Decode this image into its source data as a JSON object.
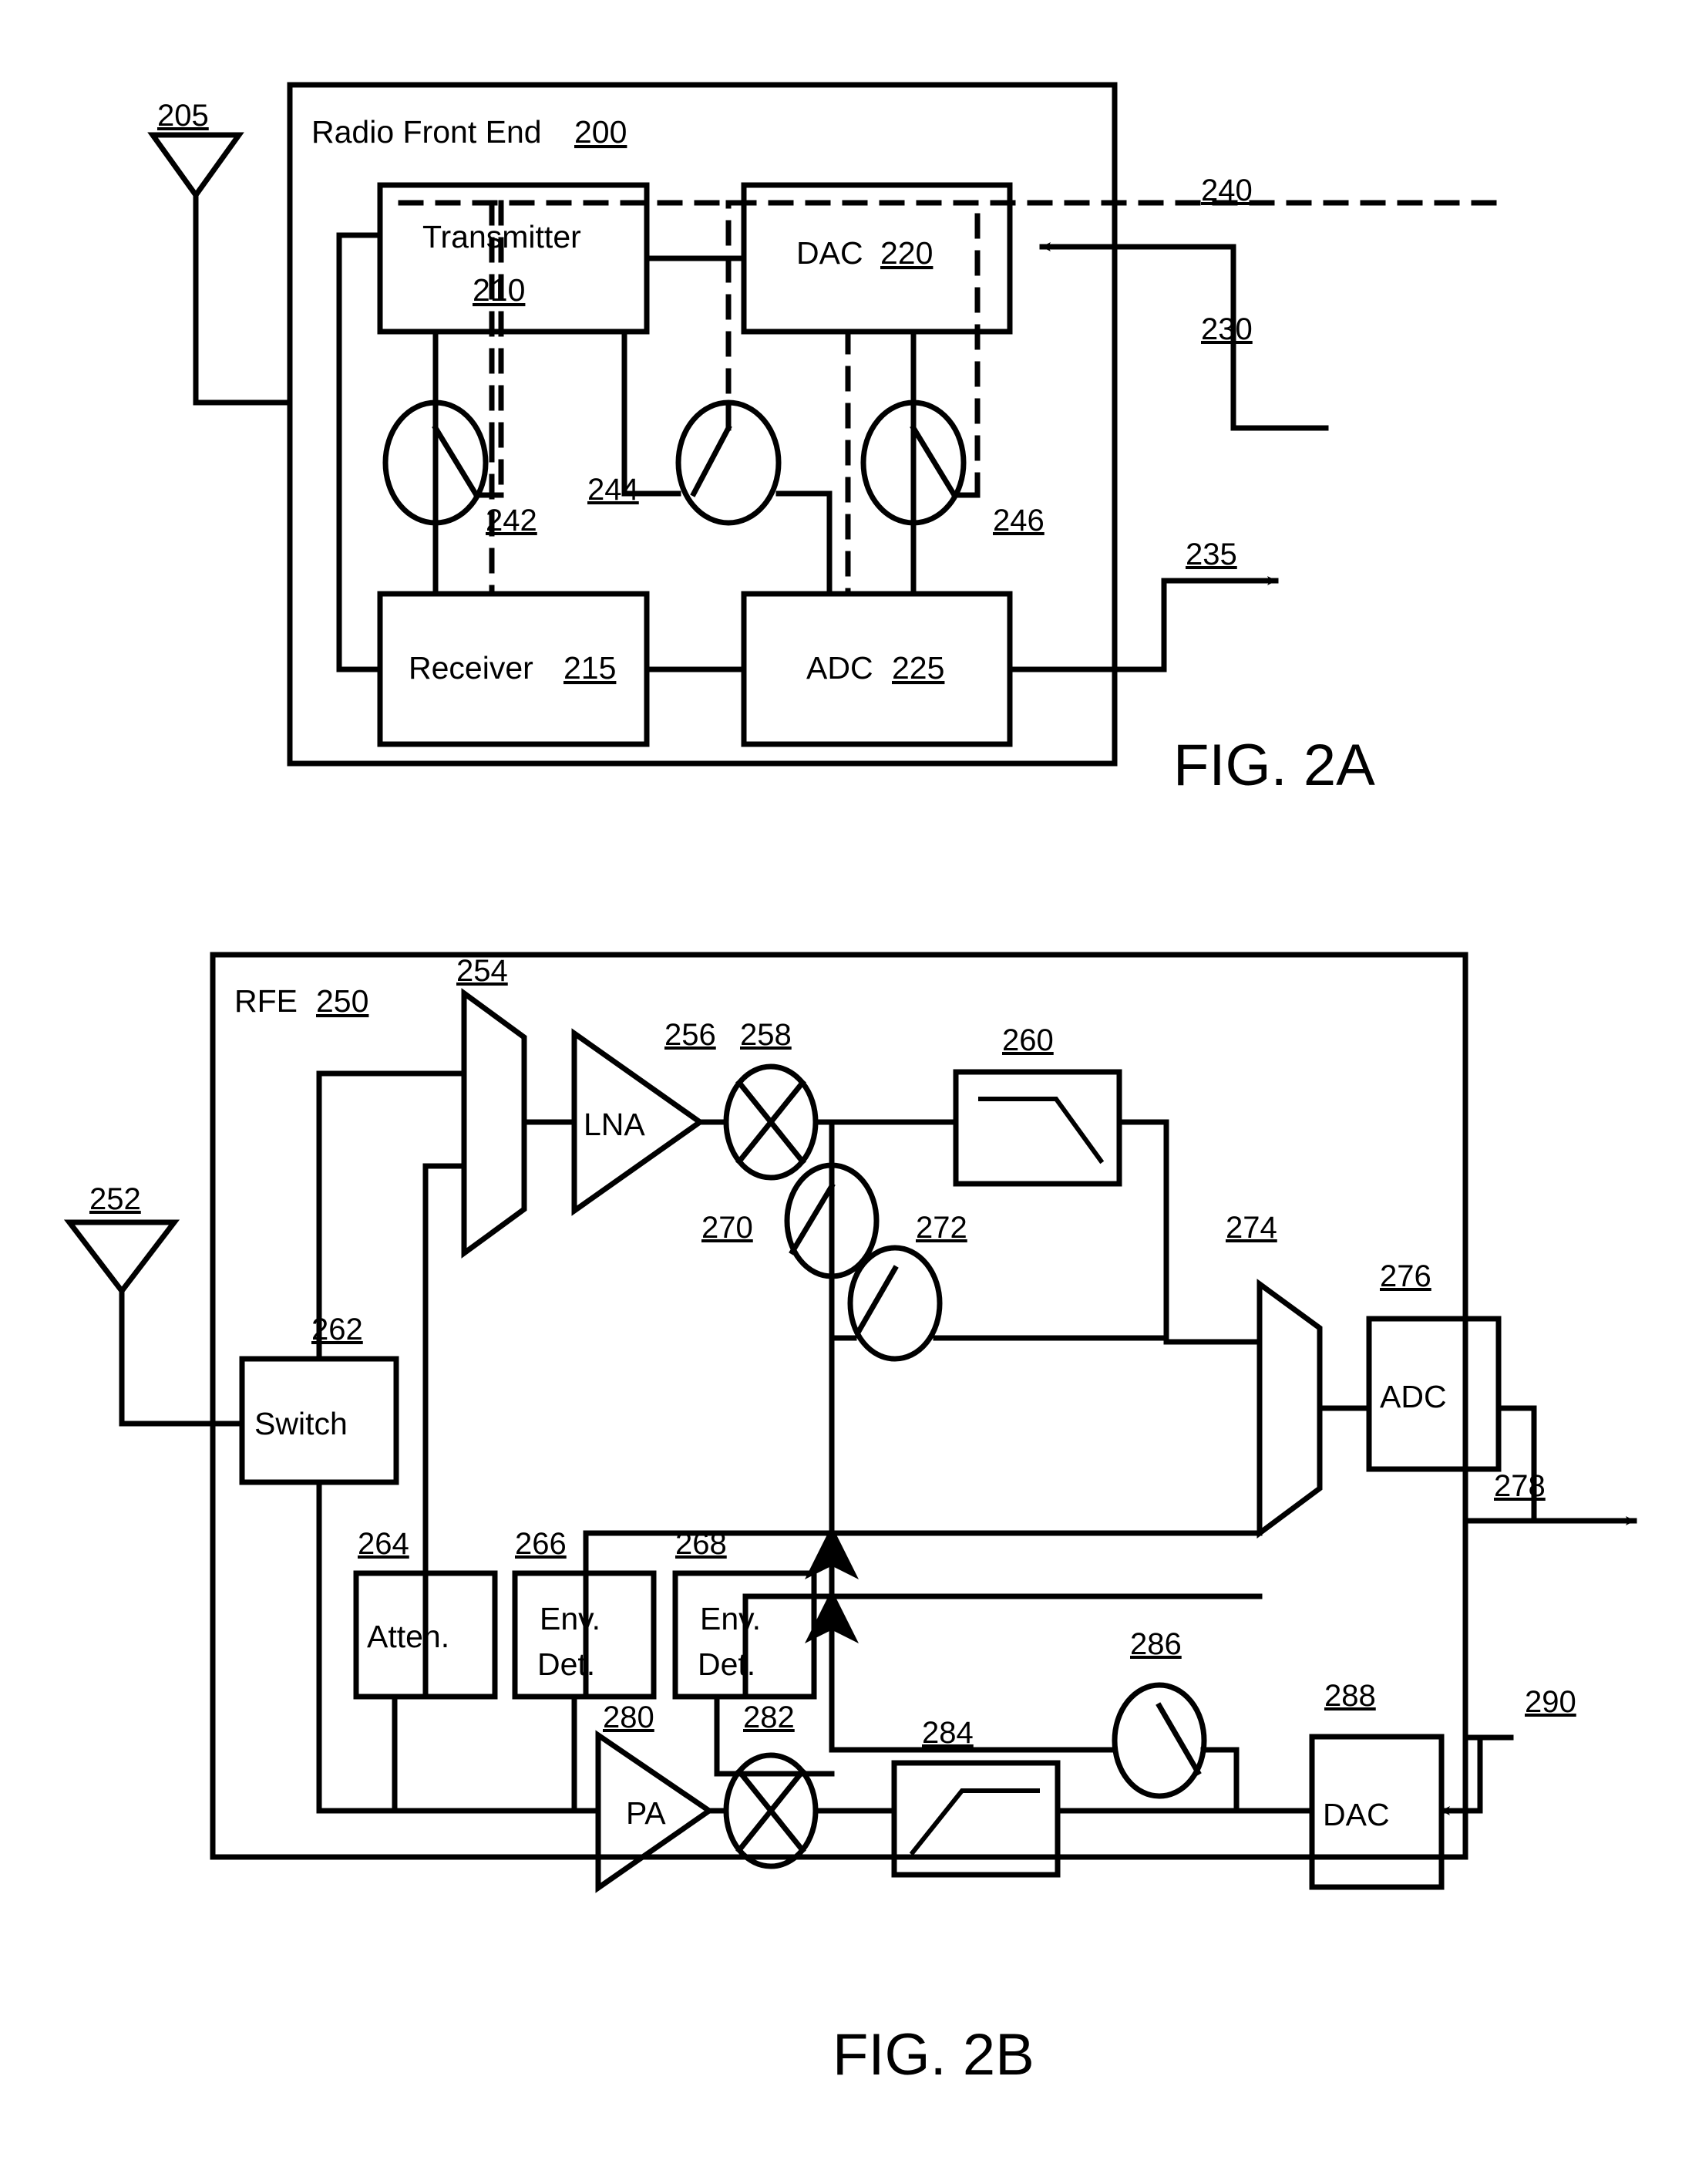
{
  "document": {
    "type": "patent-figure-sheet",
    "figures": [
      {
        "id": "fig2a",
        "caption": "FIG. 2A",
        "container": {
          "label": "Radio Front End",
          "ref": "200"
        },
        "antenna": {
          "ref": "205"
        },
        "blocks": [
          {
            "name": "transmitter",
            "label": "Transmitter",
            "ref": "210"
          },
          {
            "name": "dac",
            "label": "DAC",
            "ref": "220"
          },
          {
            "name": "receiver",
            "label": "Receiver",
            "ref": "215"
          },
          {
            "name": "adc",
            "label": "ADC",
            "ref": "225"
          }
        ],
        "switches": [
          {
            "name": "switch-242",
            "ref": "242"
          },
          {
            "name": "switch-244",
            "ref": "244"
          },
          {
            "name": "switch-246",
            "ref": "246"
          }
        ],
        "signals": [
          {
            "name": "control-line",
            "ref": "240"
          },
          {
            "name": "input-line",
            "ref": "230"
          },
          {
            "name": "output-line",
            "ref": "235"
          }
        ]
      },
      {
        "id": "fig2b",
        "caption": "FIG. 2B",
        "container": {
          "label": "RFE",
          "ref": "250"
        },
        "antenna": {
          "ref": "252"
        },
        "blocks": [
          {
            "name": "mux-254",
            "label": "",
            "ref": "254"
          },
          {
            "name": "lna",
            "label": "LNA",
            "ref": "256"
          },
          {
            "name": "mixer-258",
            "label": "",
            "ref": "258"
          },
          {
            "name": "lowpass-filter-260",
            "label": "",
            "ref": "260"
          },
          {
            "name": "switch",
            "label": "Switch",
            "ref": "262"
          },
          {
            "name": "attenuator",
            "label": "Atten.",
            "ref": "264"
          },
          {
            "name": "envelope-detector-266",
            "label": "Env. Det.",
            "ref": "266"
          },
          {
            "name": "envelope-detector-268",
            "label": "Env. Det.",
            "ref": "268"
          },
          {
            "name": "switch-270",
            "label": "",
            "ref": "270"
          },
          {
            "name": "switch-272",
            "label": "",
            "ref": "272"
          },
          {
            "name": "mux-274",
            "label": "",
            "ref": "274"
          },
          {
            "name": "adc",
            "label": "ADC",
            "ref": "276"
          },
          {
            "name": "pa",
            "label": "PA",
            "ref": "280"
          },
          {
            "name": "mixer-282",
            "label": "",
            "ref": "282"
          },
          {
            "name": "highpass-filter-284",
            "label": "",
            "ref": "284"
          },
          {
            "name": "switch-286",
            "label": "",
            "ref": "286"
          },
          {
            "name": "dac",
            "label": "DAC",
            "ref": "288"
          }
        ],
        "signals": [
          {
            "name": "output-line",
            "ref": "278"
          },
          {
            "name": "input-line",
            "ref": "290"
          }
        ]
      }
    ],
    "env_det_lines": {
      "line1": "Env.",
      "line2": "Det."
    }
  },
  "colors": {
    "ink": "#000000",
    "paper": "#ffffff"
  }
}
